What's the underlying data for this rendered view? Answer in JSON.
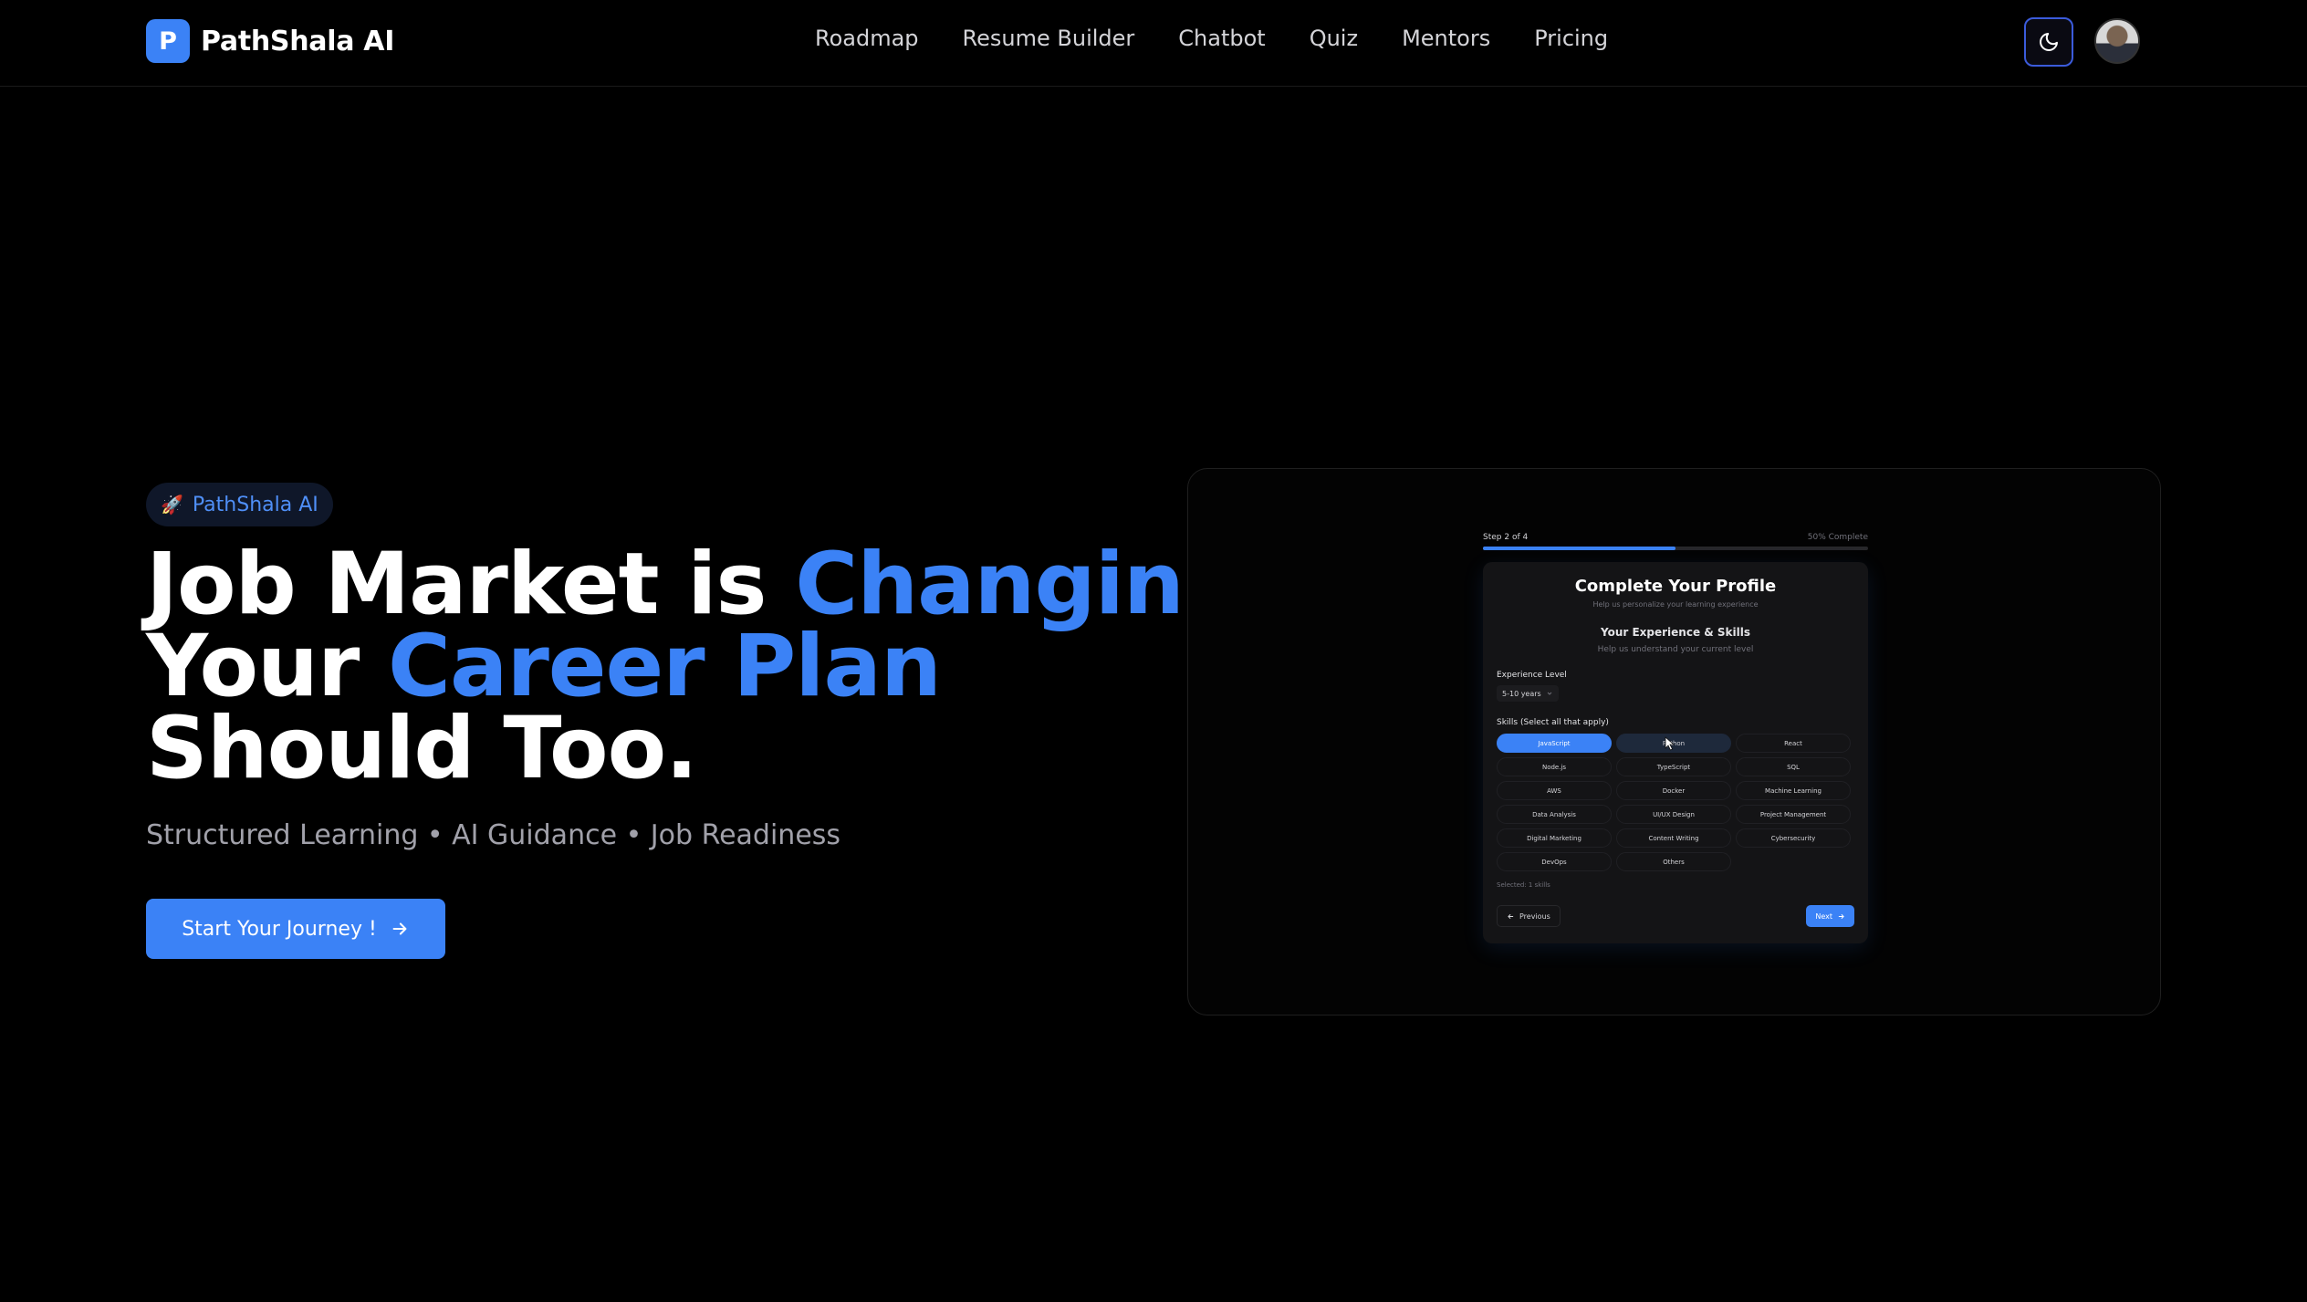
{
  "brand": {
    "logo_letter": "P",
    "name": "PathShala AI"
  },
  "nav": {
    "items": [
      "Roadmap",
      "Resume Builder",
      "Chatbot",
      "Quiz",
      "Mentors",
      "Pricing"
    ]
  },
  "icons": {
    "theme_toggle": "moon-icon",
    "badge": "rocket-icon",
    "cta": "arrow-right-icon"
  },
  "hero": {
    "badge_icon": "🚀",
    "badge_text": "PathShala AI",
    "headline": {
      "line1_a": "Job Market is ",
      "line1_b": "Changing.",
      "line2_a": "Your ",
      "line2_b": "Career Plan",
      "line3": "Should Too."
    },
    "subline": "Structured Learning • AI Guidance • Job Readiness",
    "cta_label": "Start Your Journey !"
  },
  "preview": {
    "step_label": "Step 2 of 4",
    "progress_label": "50% Complete",
    "progress": 0.5,
    "title": "Complete Your Profile",
    "subtitle": "Help us personalize your learning experience",
    "section_title": "Your Experience & Skills",
    "section_subtitle": "Help us understand your current level",
    "experience_label": "Experience Level",
    "experience_value": "5-10 years",
    "skills_label": "Skills (Select all that apply)",
    "skills": [
      "JavaScript",
      "Python",
      "React",
      "Node.js",
      "TypeScript",
      "SQL",
      "AWS",
      "Docker",
      "Machine Learning",
      "Data Analysis",
      "UI/UX Design",
      "Project Management",
      "Digital Marketing",
      "Content Writing",
      "Cybersecurity",
      "DevOps",
      "Others"
    ],
    "selected_skills": [
      "JavaScript"
    ],
    "selected_count_label": "Selected: 1 skills",
    "prev_label": "Previous",
    "next_label": "Next"
  },
  "colors": {
    "accent": "#3b82f6",
    "background": "#000000",
    "muted_text": "#a1a1aa"
  }
}
